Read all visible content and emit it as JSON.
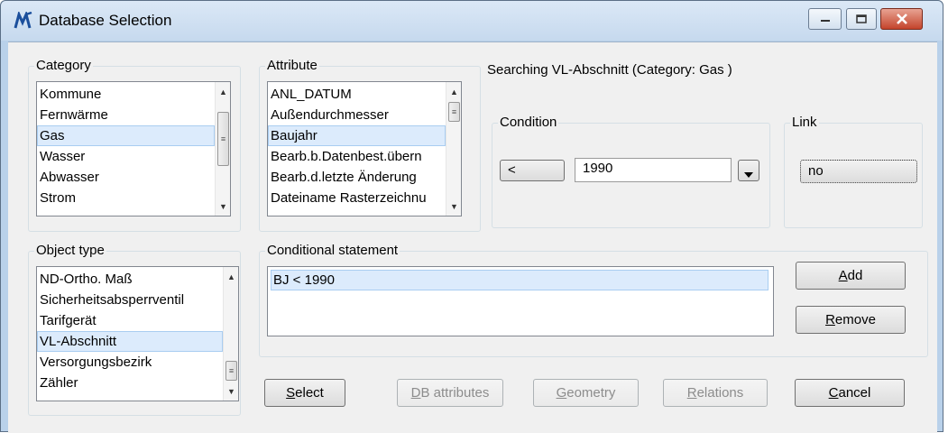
{
  "window": {
    "title": "Database Selection",
    "icons": {
      "app": "app-logo-icon",
      "minimize": "minimize-icon",
      "maximize": "maximize-icon",
      "close": "close-icon"
    },
    "colors": {
      "frame": "#b9d1ea",
      "close": "#c4442c",
      "selection": "#dcebfc"
    }
  },
  "category": {
    "label": "Category",
    "items": [
      "Kommune",
      "Fernwärme",
      "Gas",
      "Wasser",
      "Abwasser",
      "Strom"
    ],
    "selected": "Gas"
  },
  "attribute": {
    "label": "Attribute",
    "items": [
      "ANL_DATUM",
      "Außendurchmesser",
      "Baujahr",
      "Bearb.b.Datenbest.übern",
      "Bearb.d.letzte Änderung",
      "Dateiname Rasterzeichnu"
    ],
    "selected": "Baujahr"
  },
  "searching_text": "Searching VL-Abschnitt (Category: Gas )",
  "condition": {
    "label": "Condition",
    "operator": "<",
    "value": "1990"
  },
  "link": {
    "label": "Link",
    "value": "no"
  },
  "object_type": {
    "label": "Object type",
    "items": [
      "ND-Ortho. Maß",
      "Sicherheitsabsperrventil",
      "Tarifgerät",
      "VL-Abschnitt",
      "Versorgungsbezirk",
      "Zähler"
    ],
    "selected": "VL-Abschnitt"
  },
  "conditional_statement": {
    "label": "Conditional statement",
    "items": [
      "BJ < 1990"
    ]
  },
  "buttons": {
    "add_key": "A",
    "add_rest": "dd",
    "remove_key": "R",
    "remove_rest": "emove",
    "select_key": "S",
    "select_rest": "elect",
    "db_key": "D",
    "db_rest": "B attributes",
    "geometry_key": "G",
    "geometry_rest": "eometry",
    "relations_key": "R",
    "relations_rest": "elations",
    "cancel_key": "C",
    "cancel_rest": "ancel"
  }
}
